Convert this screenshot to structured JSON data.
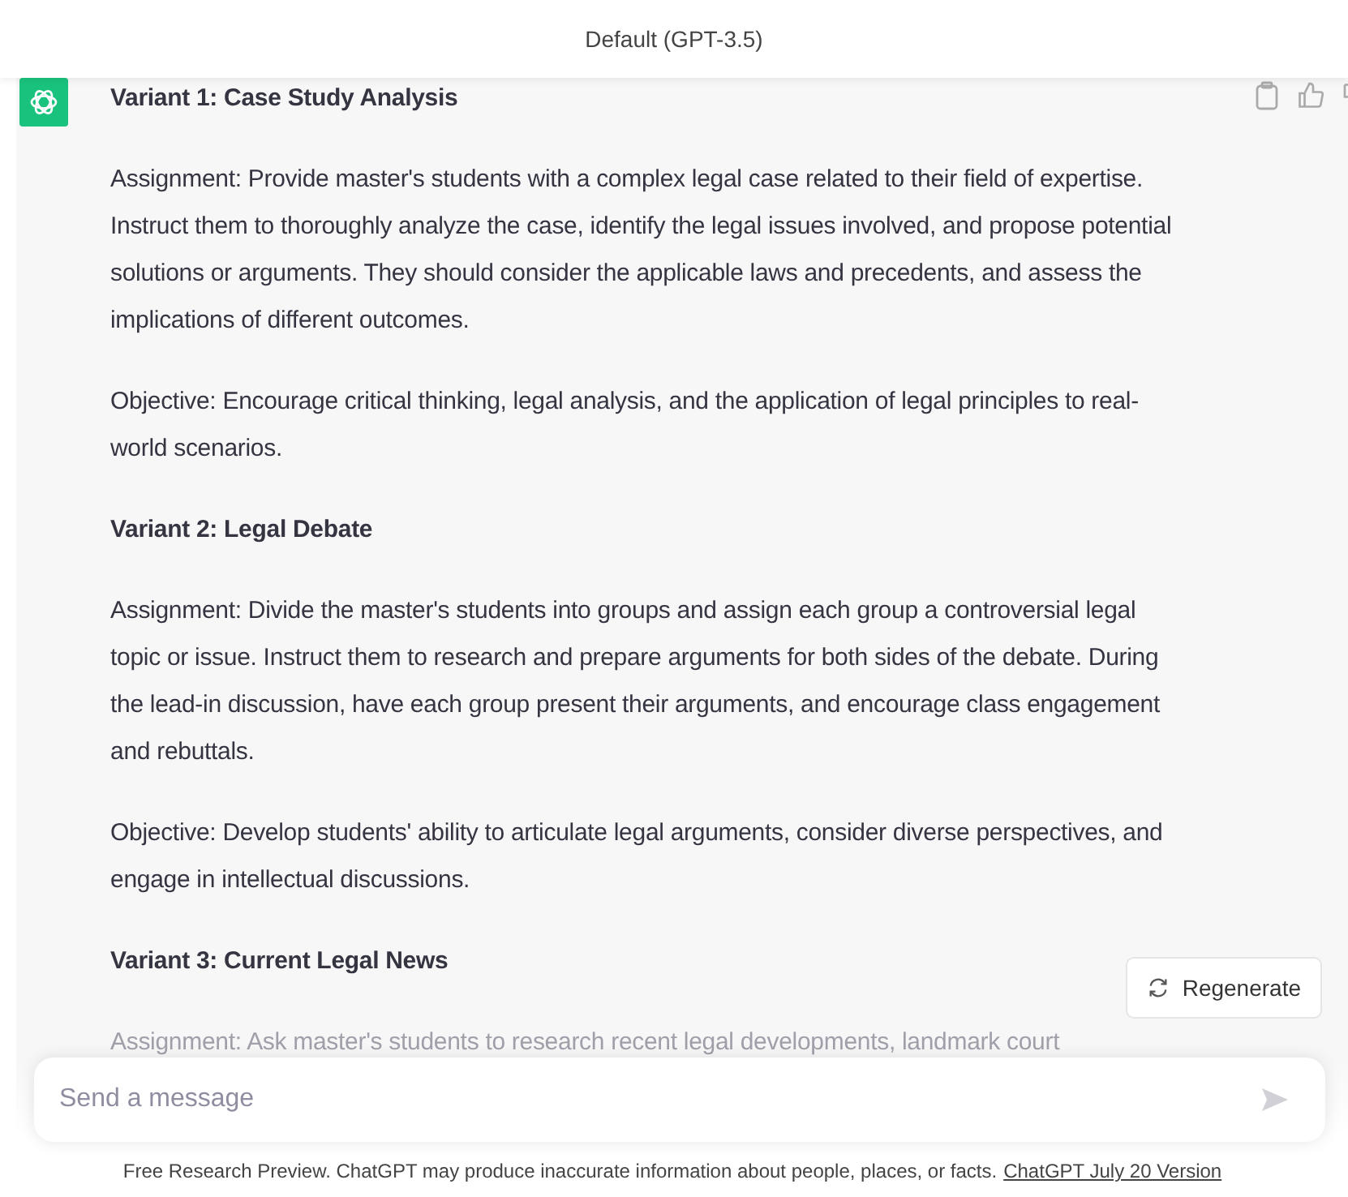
{
  "header": {
    "title": "Default (GPT-3.5)"
  },
  "message": {
    "blocks": [
      {
        "kind": "heading",
        "text": "Variant 1: Case Study Analysis"
      },
      {
        "kind": "paragraph",
        "text": "Assignment: Provide master's students with a complex legal case related to their field of expertise. Instruct them to thoroughly analyze the case, identify the legal issues involved, and propose potential solutions or arguments. They should consider the applicable laws and precedents, and assess the implications of different outcomes."
      },
      {
        "kind": "paragraph",
        "text": "Objective: Encourage critical thinking, legal analysis, and the application of legal principles to real-world scenarios."
      },
      {
        "kind": "heading",
        "text": "Variant 2: Legal Debate"
      },
      {
        "kind": "paragraph",
        "text": "Assignment: Divide the master's students into groups and assign each group a controversial legal topic or issue. Instruct them to research and prepare arguments for both sides of the debate. During the lead-in discussion, have each group present their arguments, and encourage class engagement and rebuttals."
      },
      {
        "kind": "paragraph",
        "text": "Objective: Develop students' ability to articulate legal arguments, consider diverse perspectives, and engage in intellectual discussions."
      },
      {
        "kind": "heading",
        "text": "Variant 3: Current Legal News"
      },
      {
        "kind": "paragraph",
        "text": "Assignment: Ask master's students to research recent legal developments, landmark court"
      }
    ]
  },
  "regenerate_button": {
    "label": "Regenerate"
  },
  "composer": {
    "placeholder": "Send a message"
  },
  "footer": {
    "text": "Free Research Preview. ChatGPT may produce inaccurate information about people, places, or facts.",
    "link": "ChatGPT July 20 Version"
  }
}
